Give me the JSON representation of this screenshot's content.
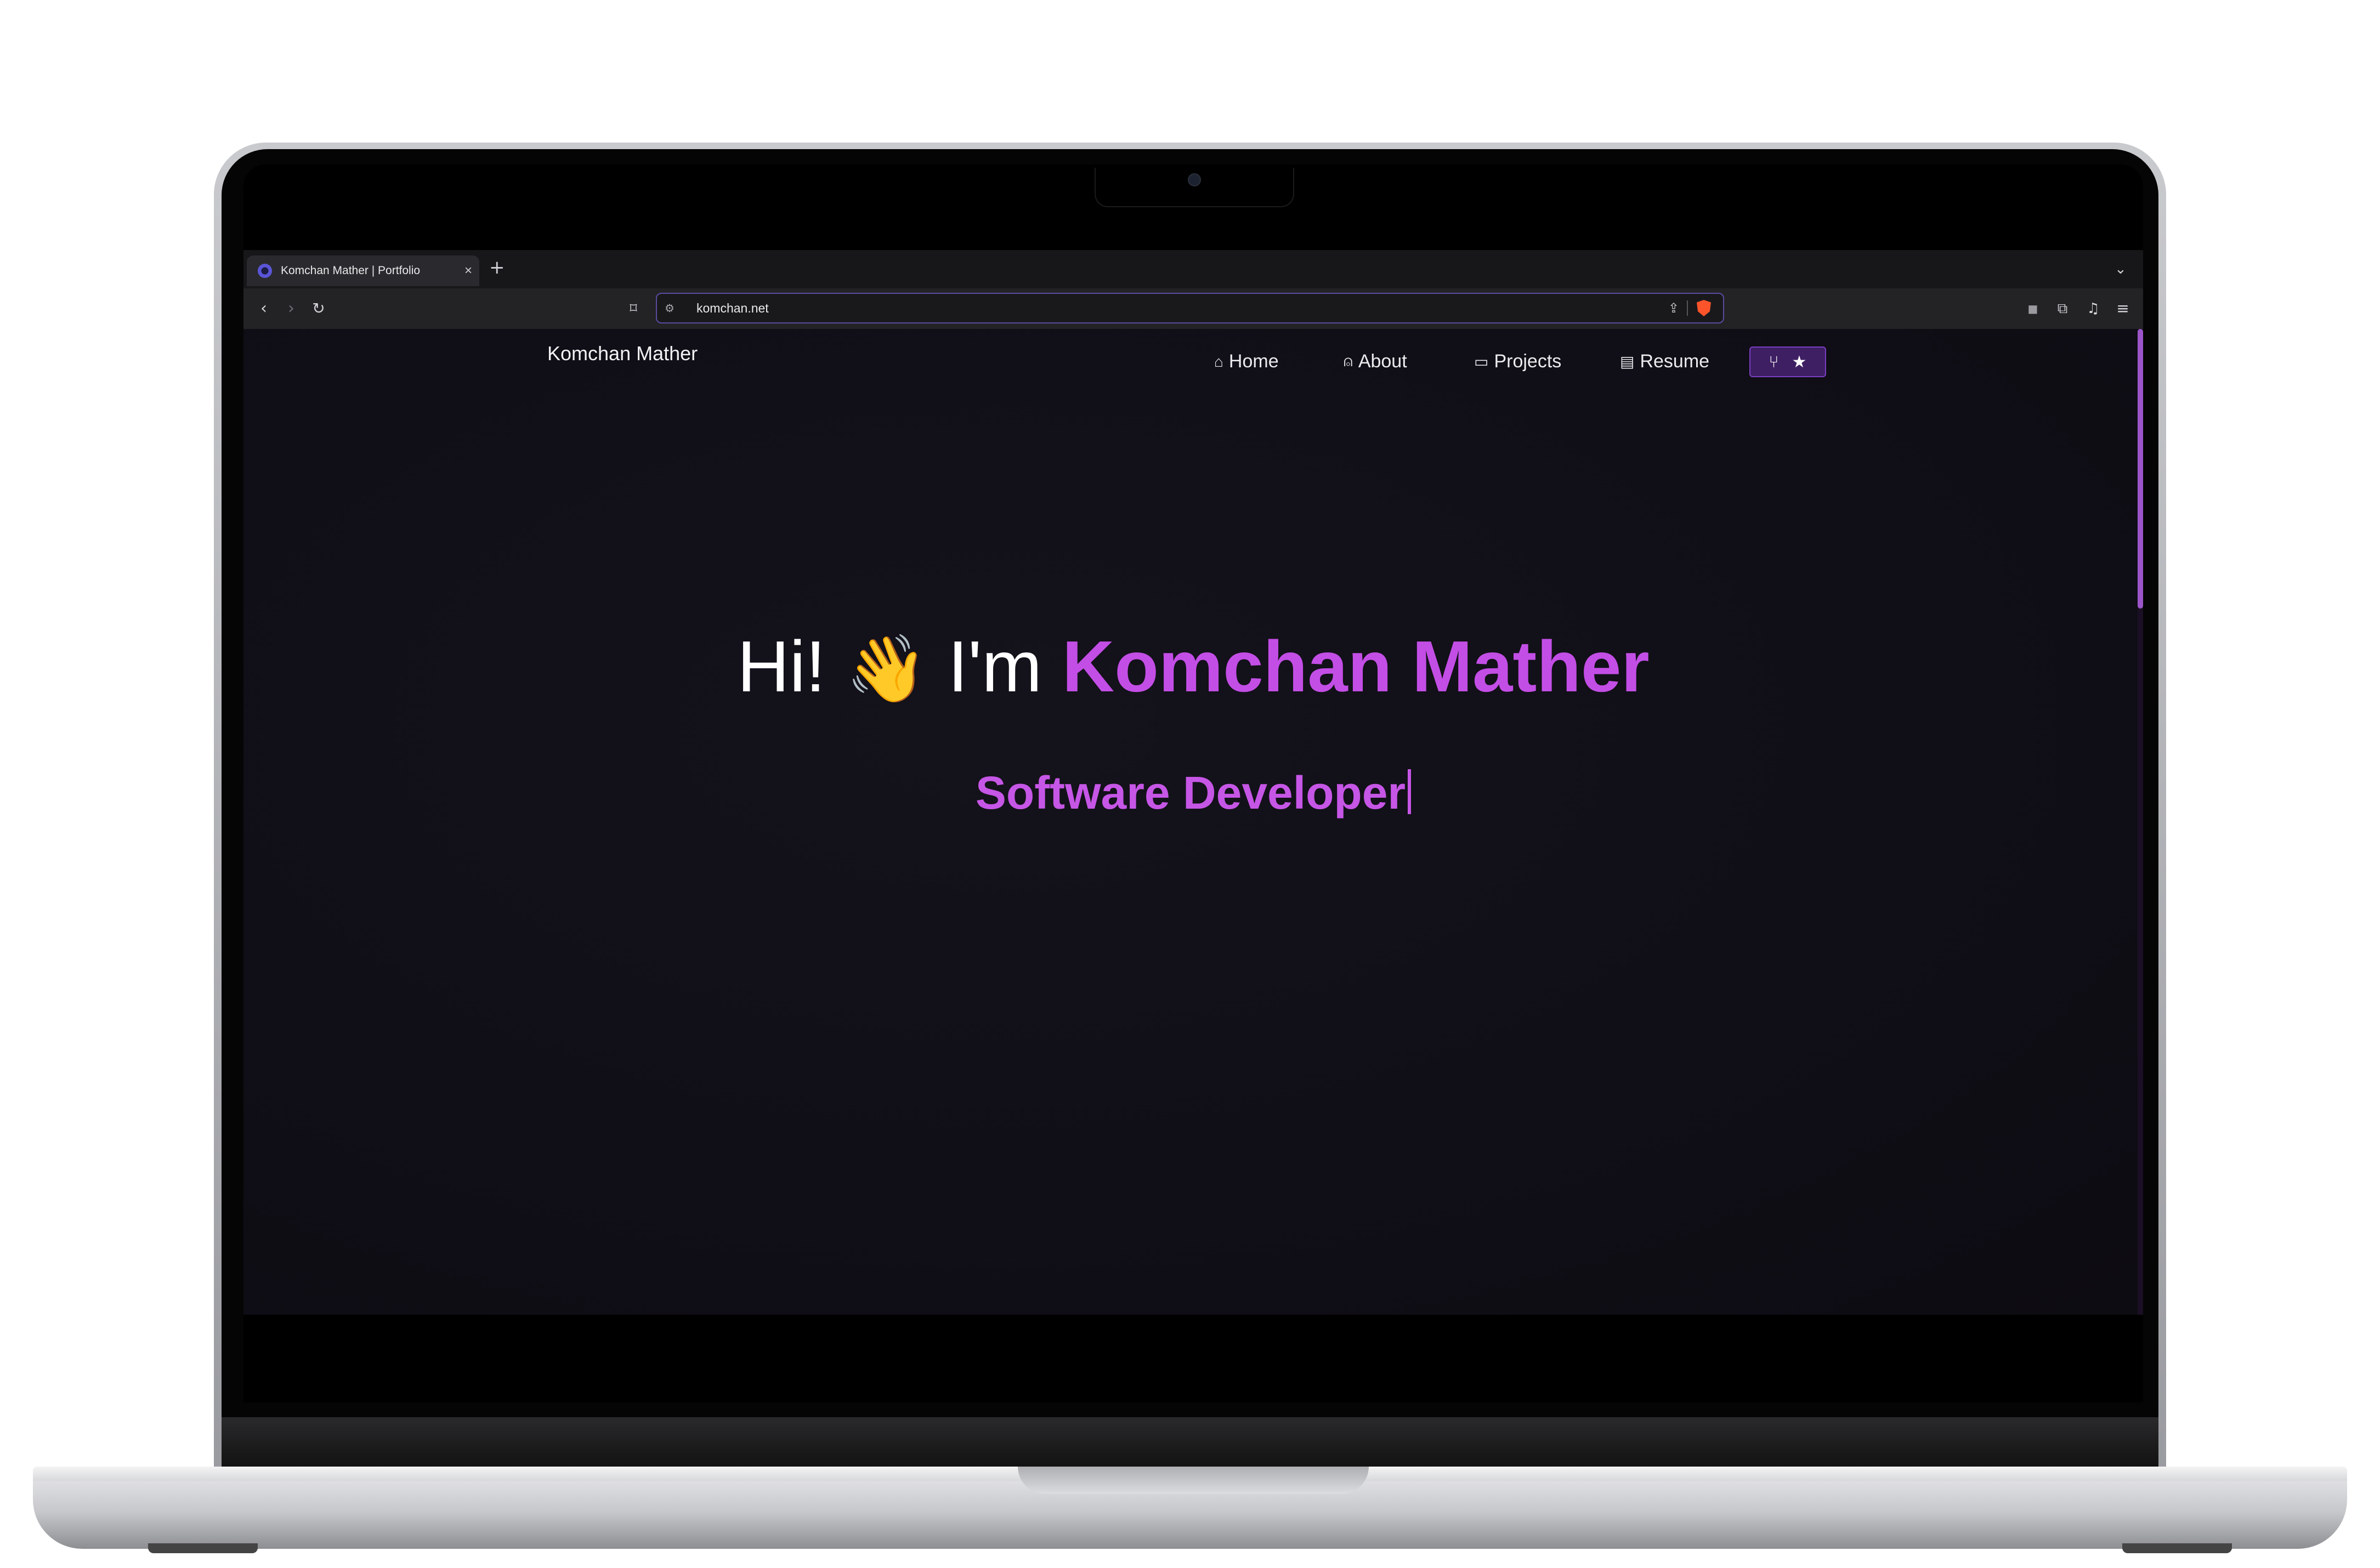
{
  "browser": {
    "tab": {
      "title": "Komchan Mather | Portfolio",
      "close_symbol": "×"
    },
    "new_tab_symbol": "+",
    "tabs_menu_symbol": "⌄",
    "url": "komchan.net"
  },
  "site": {
    "brand": "Komchan Mather",
    "nav": [
      {
        "label": "Home",
        "icon": "home-icon"
      },
      {
        "label": "About",
        "icon": "user-icon"
      },
      {
        "label": "Projects",
        "icon": "projects-icon"
      },
      {
        "label": "Resume",
        "icon": "document-icon"
      }
    ],
    "github_button": {
      "fork_icon": "fork-icon",
      "star_icon": "star-icon"
    },
    "hero": {
      "greeting": "Hi!",
      "wave_emoji": "👋",
      "intro": "I'm",
      "name": "Komchan Mather",
      "role": "Software Developer"
    }
  },
  "colors": {
    "accent": "#c34ee6",
    "page_background": "#0f0d15",
    "github_button": "#3e1f63"
  }
}
